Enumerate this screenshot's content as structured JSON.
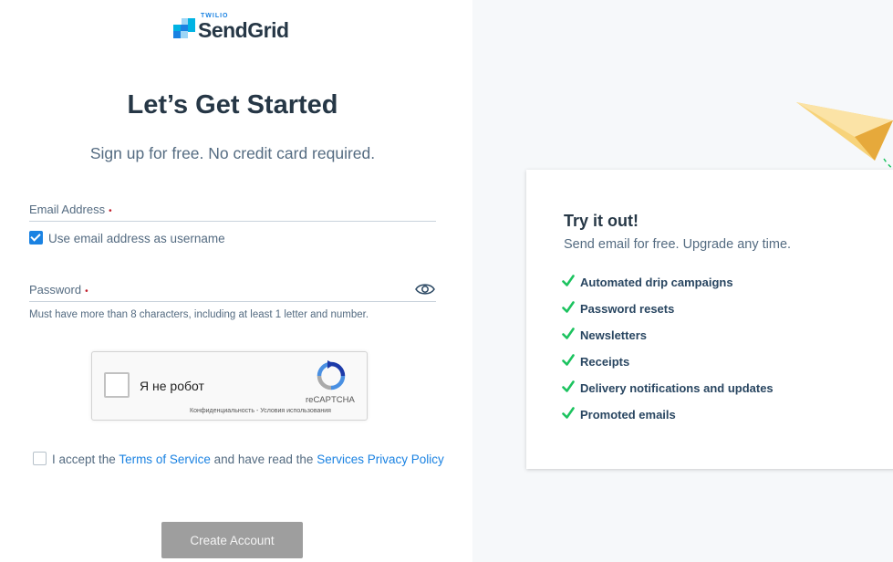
{
  "brand": {
    "twilio": "TWILIO",
    "name": "SendGrid"
  },
  "form": {
    "title": "Let’s Get Started",
    "subtitle": "Sign up for free. No credit card required.",
    "email_label": "Email Address",
    "required_mark": "•",
    "use_email_username": "Use email address as username",
    "use_email_checked": true,
    "password_label": "Password",
    "password_hint": "Must have more than 8 characters, including at least 1 letter and number.",
    "tos_prefix": "I accept the ",
    "tos_link": "Terms of Service",
    "tos_middle": " and have read the ",
    "privacy_link": "Services Privacy Policy",
    "create_button": "Create Account"
  },
  "captcha": {
    "label": "Я не робот",
    "brand": "reCAPTCHA",
    "links": "Конфиденциальность - Условия использования"
  },
  "promo": {
    "title": "Try it out!",
    "subtitle": "Send email for free. Upgrade any time.",
    "features": [
      "Automated drip campaigns",
      "Password resets",
      "Newsletters",
      "Receipts",
      "Delivery notifications and updates",
      "Promoted emails"
    ]
  },
  "icons": {
    "logo": "sendgrid-logo-icon",
    "eye": "eye-icon",
    "check": "check-icon",
    "captcha": "recaptcha-icon",
    "plane": "paper-plane-icon"
  },
  "colors": {
    "primary": "#1a82e2",
    "heading": "#263746",
    "text": "#546b81",
    "check": "#1cc35f",
    "button_disabled": "#9e9e9e",
    "required": "#c11f2c",
    "plane": "#f2c14e"
  }
}
